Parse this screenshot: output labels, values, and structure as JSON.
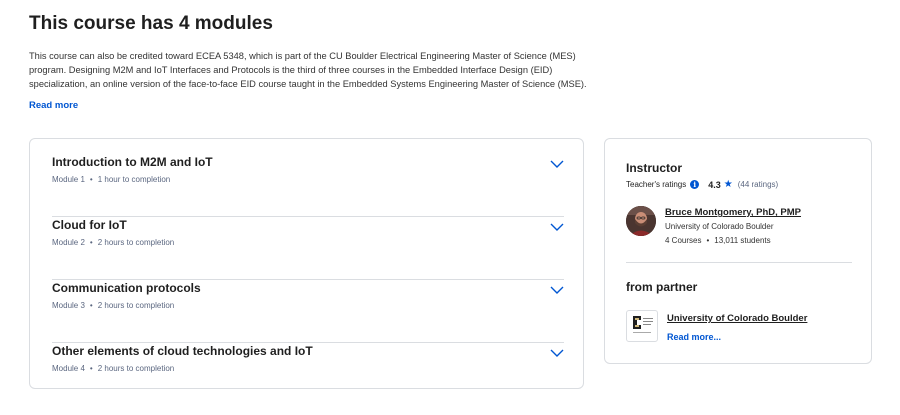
{
  "heading": "This course has 4 modules",
  "description": "This course can also be credited toward ECEA 5348, which is part of the CU Boulder Electrical Engineering Master of Science (MES) program. Designing M2M and IoT Interfaces and Protocols is the third of three courses in the Embedded Interface Design (EID) specialization, an online version of the face-to-face EID course taught in the Embedded Systems Engineering Master of Science (MSE).",
  "read_more": "Read more",
  "modules": [
    {
      "title": "Introduction to M2M and IoT",
      "module": "Module 1",
      "duration": "1 hour to completion",
      "separator": "•"
    },
    {
      "title": "Cloud for IoT",
      "module": "Module 2",
      "duration": "2 hours to completion",
      "separator": "•"
    },
    {
      "title": "Communication protocols",
      "module": "Module 3",
      "duration": "2 hours to completion",
      "separator": "•"
    },
    {
      "title": "Other elements of cloud technologies and IoT",
      "module": "Module 4",
      "duration": "2 hours to completion",
      "separator": "•"
    }
  ],
  "instructor": {
    "heading": "Instructor",
    "ratings_label": "Teacher's ratings",
    "info_icon": "i",
    "rating": "4.3",
    "star": "★",
    "rating_count": "(44 ratings)",
    "name": "Bruce Montgomery, PhD, PMP",
    "org": "University of Colorado Boulder",
    "courses": "4 Courses",
    "separator": "•",
    "students": "13,011 students"
  },
  "partner": {
    "heading": "from partner",
    "name": "University of Colorado Boulder",
    "read_more": "Read more...",
    "logo_text": "University of Colorado Boulder"
  },
  "colors": {
    "accent": "#0056d2",
    "border": "#dadde1",
    "meta": "#5b6780"
  }
}
